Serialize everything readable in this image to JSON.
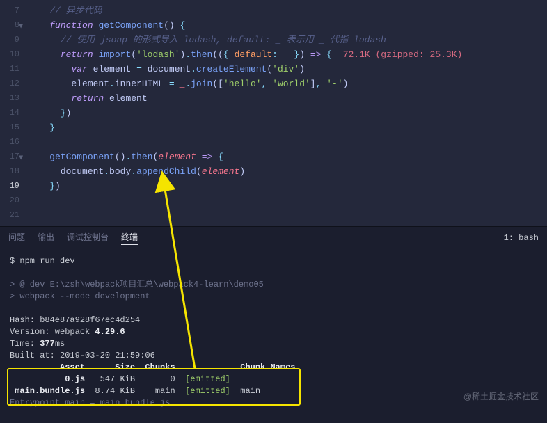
{
  "gutter": {
    "start": 7,
    "end": 21,
    "current": 19
  },
  "code": {
    "l7": "// 异步代码",
    "l8_fn": "function",
    "l8_name": "getComponent",
    "l10_c": "// 使用 jsonp 的形式导入 lodash, default: _ 表示用 _ 代指 lodash",
    "l11_ret": "return",
    "l11_import": "import",
    "l11_str": "'lodash'",
    "l11_then": "then",
    "l11_default": "default",
    "l11_under": "_",
    "l11_size": "  72.1K (gzipped: 25.3K)",
    "l12_var": "var",
    "l12_el": "element",
    "l12_doc": "document",
    "l12_ce": "createElement",
    "l12_div": "'div'",
    "l13_el": "element",
    "l13_ih": "innerHTML",
    "l13_under": "_",
    "l13_join": "join",
    "l13_s1": "'hello'",
    "l13_s2": "'world'",
    "l13_s3": "'-'",
    "l14_ret": "return",
    "l14_el": "element",
    "l18_gc": "getComponent",
    "l18_then": "then",
    "l18_el": "element",
    "l19_doc": "document",
    "l19_body": "body",
    "l19_ac": "appendChild",
    "l19_el": "element"
  },
  "panel": {
    "tabs": [
      "问题",
      "输出",
      "调试控制台",
      "终端"
    ],
    "activeIndex": 3,
    "shell": "1: bash"
  },
  "terminal": {
    "prompt": "$ npm run dev",
    "run1": "> @ dev E:\\zsh\\webpack项目汇总\\webpack4-learn\\demo05",
    "run2": "> webpack --mode development",
    "hash": "Hash: b84e87a928f67ec4d254",
    "verLabel": "Version: webpack ",
    "verVal": "4.29.6",
    "timeLabel": "Time: ",
    "timeVal": "377",
    "timeUnit": "ms",
    "built": "Built at: 2019-03-20 21:59:06",
    "hdr": "          Asset      Size  Chunks             Chunk Names",
    "row1_asset": "           0.js",
    "row1_size": "   547 KiB",
    "row1_chunk": "       0",
    "row1_emit": "[emitted]",
    "row2_asset": " main.bundle.js",
    "row2_size": "  8.74 KiB",
    "row2_chunk": "    main",
    "row2_emit": "[emitted]",
    "row2_name": "  main",
    "entry": "Entrypoint main = main.bundle.js"
  },
  "watermark": "@稀土掘金技术社区"
}
